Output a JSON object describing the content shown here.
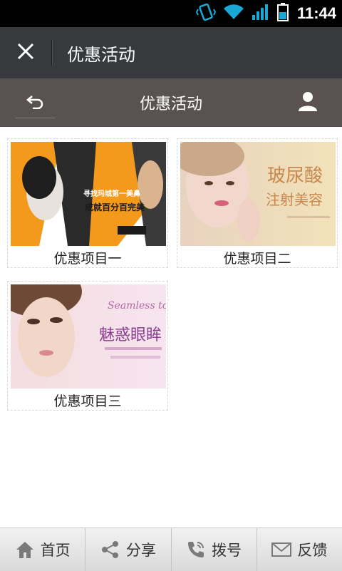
{
  "status_bar": {
    "time": "11:44",
    "icons": [
      "vibrate-icon",
      "wifi-icon",
      "signal-icon",
      "battery-icon"
    ]
  },
  "title_bar": {
    "title": "优惠活动",
    "close_icon": "close-icon"
  },
  "page_header": {
    "title": "优惠活动",
    "back_icon": "back-arrow-icon",
    "user_icon": "user-icon"
  },
  "promotions": [
    {
      "label": "优惠项目一",
      "image_text": [
        "寻找玛城第一美鼻",
        "成就百分百完美"
      ],
      "accent": "#f39a1c"
    },
    {
      "label": "优惠项目二",
      "image_text": [
        "玻尿酸",
        "注射美容"
      ],
      "accent": "#c9884e"
    },
    {
      "label": "优惠项目三",
      "image_text": [
        "Seamless to",
        "魅惑眼眸"
      ],
      "accent": "#8a3f8f"
    }
  ],
  "bottom_nav": {
    "items": [
      {
        "label": "首页",
        "icon": "home-icon"
      },
      {
        "label": "分享",
        "icon": "share-icon"
      },
      {
        "label": "拨号",
        "icon": "phone-icon"
      },
      {
        "label": "反馈",
        "icon": "mail-icon"
      }
    ]
  },
  "colors": {
    "status_bar": "#000000",
    "title_bar": "#363a3c",
    "page_header": "#5a5250",
    "status_icons": "#19a8d6"
  }
}
